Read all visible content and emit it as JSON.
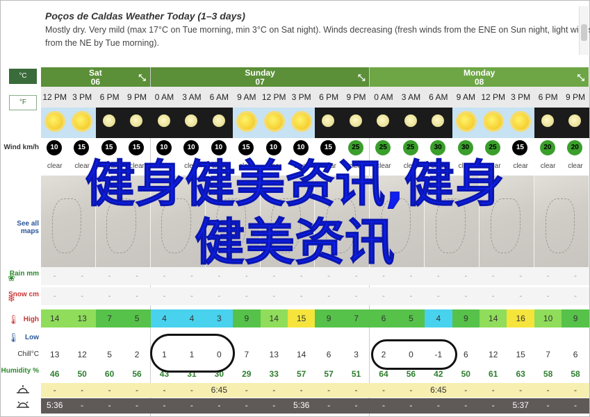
{
  "header": {
    "title": "Poços de Caldas Weather Today (1–3 days)",
    "summary": "Mostly dry. Very mild (max 17°C on Tue morning, min 3°C on Sat night). Winds decreasing (fresh winds from the ENE on Sun night, light winds from the NE by Tue morning)."
  },
  "units": {
    "celsius": "°C",
    "fahrenheit": "°F"
  },
  "labels": {
    "wind": "Wind km/h",
    "maps": "See all maps",
    "rain": "Rain mm",
    "snow": "Snow cm",
    "high": "High",
    "low": "Low",
    "chill": "Chill°C",
    "humidity": "Humidity %"
  },
  "days": [
    {
      "name": "Sat",
      "date": "06",
      "cols": 4
    },
    {
      "name": "Sunday",
      "date": "07",
      "cols": 8
    },
    {
      "name": "Monday",
      "date": "08",
      "cols": 8
    }
  ],
  "times": [
    "12 PM",
    "3 PM",
    "6 PM",
    "9 PM",
    "0 AM",
    "3 AM",
    "6 AM",
    "9 AM",
    "12 PM",
    "3 PM",
    "6 PM",
    "9 PM",
    "0 AM",
    "3 AM",
    "6 AM",
    "9 AM",
    "12 PM",
    "3 PM",
    "6 PM",
    "9 PM"
  ],
  "sky": [
    "day",
    "day",
    "night",
    "night",
    "night",
    "night",
    "night",
    "day",
    "day",
    "day",
    "night",
    "night",
    "night",
    "night",
    "night",
    "day",
    "day",
    "day",
    "night",
    "night"
  ],
  "wind": [
    "10",
    "15",
    "15",
    "15",
    "10",
    "10",
    "10",
    "15",
    "10",
    "10",
    "15",
    "25",
    "25",
    "25",
    "30",
    "30",
    "25",
    "15",
    "20",
    "20"
  ],
  "wind_colors": [
    "dark",
    "dark",
    "dark",
    "dark",
    "dark",
    "dark",
    "dark",
    "dark",
    "dark",
    "dark",
    "dark",
    "green",
    "green",
    "green",
    "green",
    "green",
    "green",
    "dark",
    "green",
    "green"
  ],
  "conditions": [
    "clear",
    "clear",
    "clear",
    "clear",
    "clear",
    "clear",
    "clear",
    "clear",
    "clear",
    "clear",
    "clear",
    "clear",
    "clear",
    "clear",
    "clear",
    "clear",
    "clear",
    "clear",
    "clear",
    "clear"
  ],
  "rain": [
    "-",
    "-",
    "-",
    "-",
    "-",
    "-",
    "-",
    "-",
    "-",
    "-",
    "-",
    "-",
    "-",
    "-",
    "-",
    "-",
    "-",
    "-",
    "-",
    "-"
  ],
  "snow": [
    "-",
    "-",
    "-",
    "-",
    "-",
    "-",
    "-",
    "-",
    "-",
    "-",
    "-",
    "-",
    "-",
    "-",
    "-",
    "-",
    "-",
    "-",
    "-",
    "-"
  ],
  "high": [
    "14",
    "13",
    "7",
    "5",
    "4",
    "4",
    "3",
    "9",
    "14",
    "15",
    "9",
    "7",
    "6",
    "5",
    "4",
    "9",
    "14",
    "16",
    "10",
    "9"
  ],
  "high_colors": [
    "#8fdd5a",
    "#8fdd5a",
    "#56c24a",
    "#56c24a",
    "#49d2ee",
    "#49d2ee",
    "#49d2ee",
    "#56c24a",
    "#8fdd5a",
    "#f5e43c",
    "#56c24a",
    "#56c24a",
    "#56c24a",
    "#56c24a",
    "#49d2ee",
    "#56c24a",
    "#8fdd5a",
    "#f5e43c",
    "#8fdd5a",
    "#56c24a"
  ],
  "low": [
    "",
    "",
    "",
    "",
    "",
    "",
    "",
    "",
    "",
    "",
    "",
    "",
    "",
    "",
    "",
    "",
    "",
    "",
    "",
    ""
  ],
  "chill": [
    "13",
    "12",
    "5",
    "2",
    "1",
    "1",
    "0",
    "7",
    "13",
    "14",
    "6",
    "3",
    "2",
    "0",
    "-1",
    "6",
    "12",
    "15",
    "7",
    "6"
  ],
  "humidity": [
    "46",
    "50",
    "60",
    "56",
    "43",
    "31",
    "30",
    "29",
    "33",
    "57",
    "57",
    "51",
    "64",
    "56",
    "42",
    "50",
    "61",
    "63",
    "58",
    "58"
  ],
  "sunrise": [
    "-",
    "-",
    "-",
    "-",
    "-",
    "-",
    "6:45",
    "-",
    "-",
    "-",
    "-",
    "-",
    "-",
    "-",
    "6:45",
    "-",
    "-",
    "-",
    "-",
    "-"
  ],
  "sunset": [
    "5:36",
    "-",
    "-",
    "-",
    "-",
    "-",
    "-",
    "-",
    "-",
    "5:36",
    "-",
    "-",
    "-",
    "-",
    "-",
    "-",
    "-",
    "5:37",
    "-",
    "-"
  ],
  "overlay": {
    "line1": "健身健美资讯,健身",
    "line2": "健美资讯"
  }
}
